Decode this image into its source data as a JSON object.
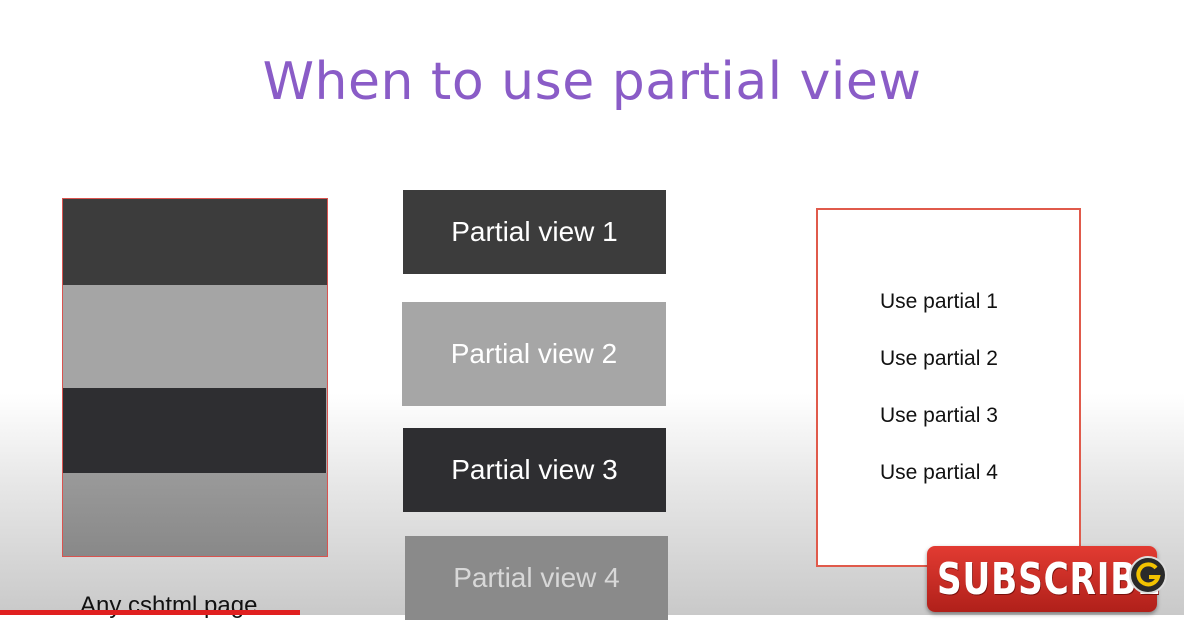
{
  "slide": {
    "title": "When to use partial view"
  },
  "left_page": {
    "caption": "Any cshtml page"
  },
  "partials": [
    {
      "label": "Partial view 1",
      "color": "#3c3c3c"
    },
    {
      "label": "Partial view 2",
      "color": "#a6a6a6"
    },
    {
      "label": "Partial view 3",
      "color": "#2e2e31"
    },
    {
      "label": "Partial view 4",
      "color": "#8a8a8a"
    }
  ],
  "use_box": {
    "items": [
      "Use partial 1",
      "Use partial 2",
      "Use partial 3",
      "Use partial 4"
    ]
  },
  "overlay": {
    "subscribe_label": "SUBSCRIBE",
    "logo_icon": "channel-logo-icon"
  },
  "colors": {
    "title": "#8a5cc7",
    "border": "#e05a4b",
    "subscribe": "#e23b32"
  }
}
